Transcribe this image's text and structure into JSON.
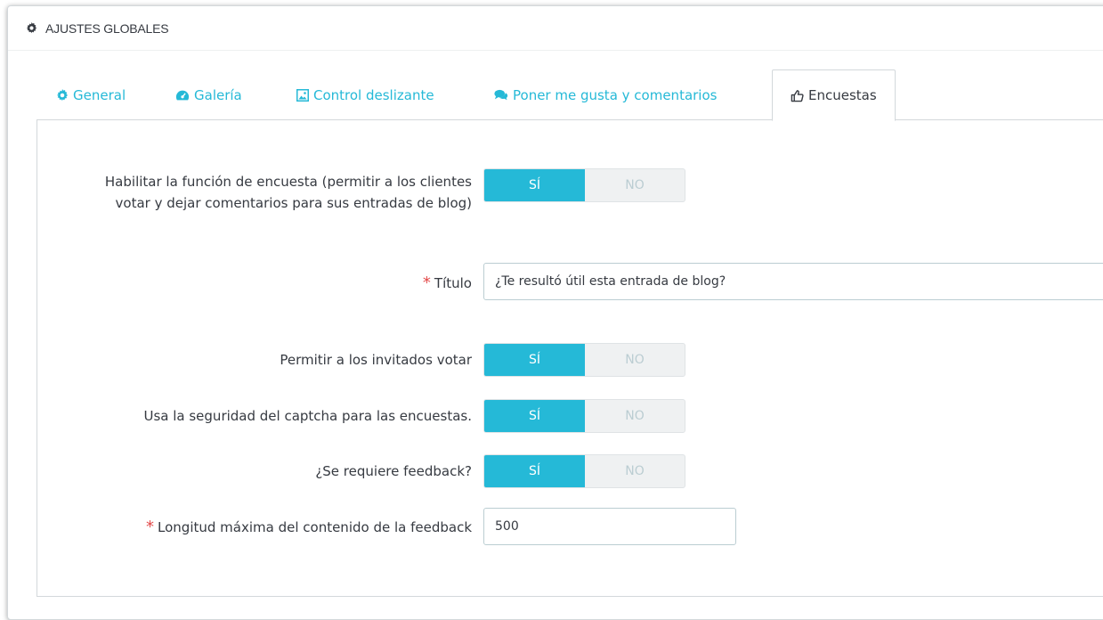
{
  "panel": {
    "title": "AJUSTES GLOBALES",
    "icon": "gear-icon"
  },
  "tabs": [
    {
      "label": "General",
      "icon": "cog-icon",
      "active": false
    },
    {
      "label": "Galería",
      "icon": "dashboard-icon",
      "active": false
    },
    {
      "label": "Control deslizante",
      "icon": "image-icon",
      "active": false
    },
    {
      "label": "Poner me gusta y comentarios",
      "icon": "comments-icon",
      "active": false
    },
    {
      "label": "Encuestas",
      "icon": "thumbs-up-icon",
      "active": true
    }
  ],
  "form": {
    "enable_poll": {
      "label": "Habilitar la función de encuesta (permitir a los clientes votar y dejar comentarios para sus entradas de blog)",
      "yes": "SÍ",
      "no": "NO",
      "value": "yes"
    },
    "title": {
      "required_mark": "*",
      "label": "Título",
      "value": "¿Te resultó útil esta entrada de blog?"
    },
    "guests_vote": {
      "label": "Permitir a los invitados votar",
      "yes": "SÍ",
      "no": "NO",
      "value": "yes"
    },
    "captcha": {
      "label": "Usa la seguridad del captcha para las encuestas.",
      "yes": "SÍ",
      "no": "NO",
      "value": "yes"
    },
    "feedback_required": {
      "label": "¿Se requiere feedback?",
      "yes": "SÍ",
      "no": "NO",
      "value": "yes"
    },
    "max_length": {
      "required_mark": "*",
      "label": "Longitud máxima del contenido de la feedback",
      "value": "500"
    }
  },
  "colors": {
    "accent": "#25b9d7",
    "required": "#e34a4a",
    "text": "#363a41",
    "border": "#d3d8db"
  }
}
